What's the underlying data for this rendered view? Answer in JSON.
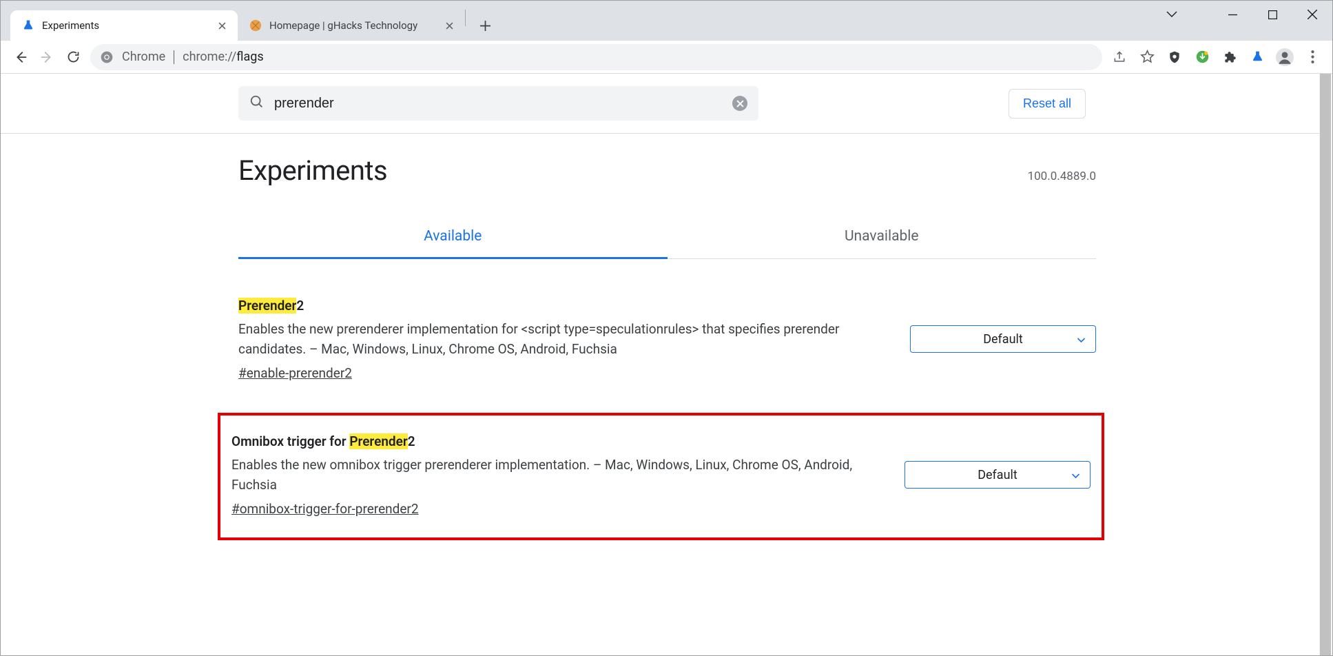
{
  "window": {
    "tabs": [
      {
        "title": "Experiments",
        "active": true
      },
      {
        "title": "Homepage | gHacks Technology",
        "active": false
      }
    ]
  },
  "address": {
    "scheme_label": "Chrome",
    "url_prefix": "chrome://",
    "url_path": "flags"
  },
  "search": {
    "value": "prerender"
  },
  "reset_label": "Reset all",
  "page_title": "Experiments",
  "version": "100.0.4889.0",
  "tabs": {
    "available": "Available",
    "unavailable": "Unavailable"
  },
  "flags": [
    {
      "title_pre": "",
      "title_hl": "Prerender",
      "title_post": "2",
      "desc": "Enables the new prerenderer implementation for <script type=speculationrules> that specifies prerender candidates. – Mac, Windows, Linux, Chrome OS, Android, Fuchsia",
      "hash": "#enable-prerender2",
      "select": "Default",
      "highlight": false
    },
    {
      "title_pre": "Omnibox trigger for ",
      "title_hl": "Prerender",
      "title_post": "2",
      "desc": "Enables the new omnibox trigger prerenderer implementation. – Mac, Windows, Linux, Chrome OS, Android, Fuchsia",
      "hash": "#omnibox-trigger-for-prerender2",
      "select": "Default",
      "highlight": true
    }
  ]
}
